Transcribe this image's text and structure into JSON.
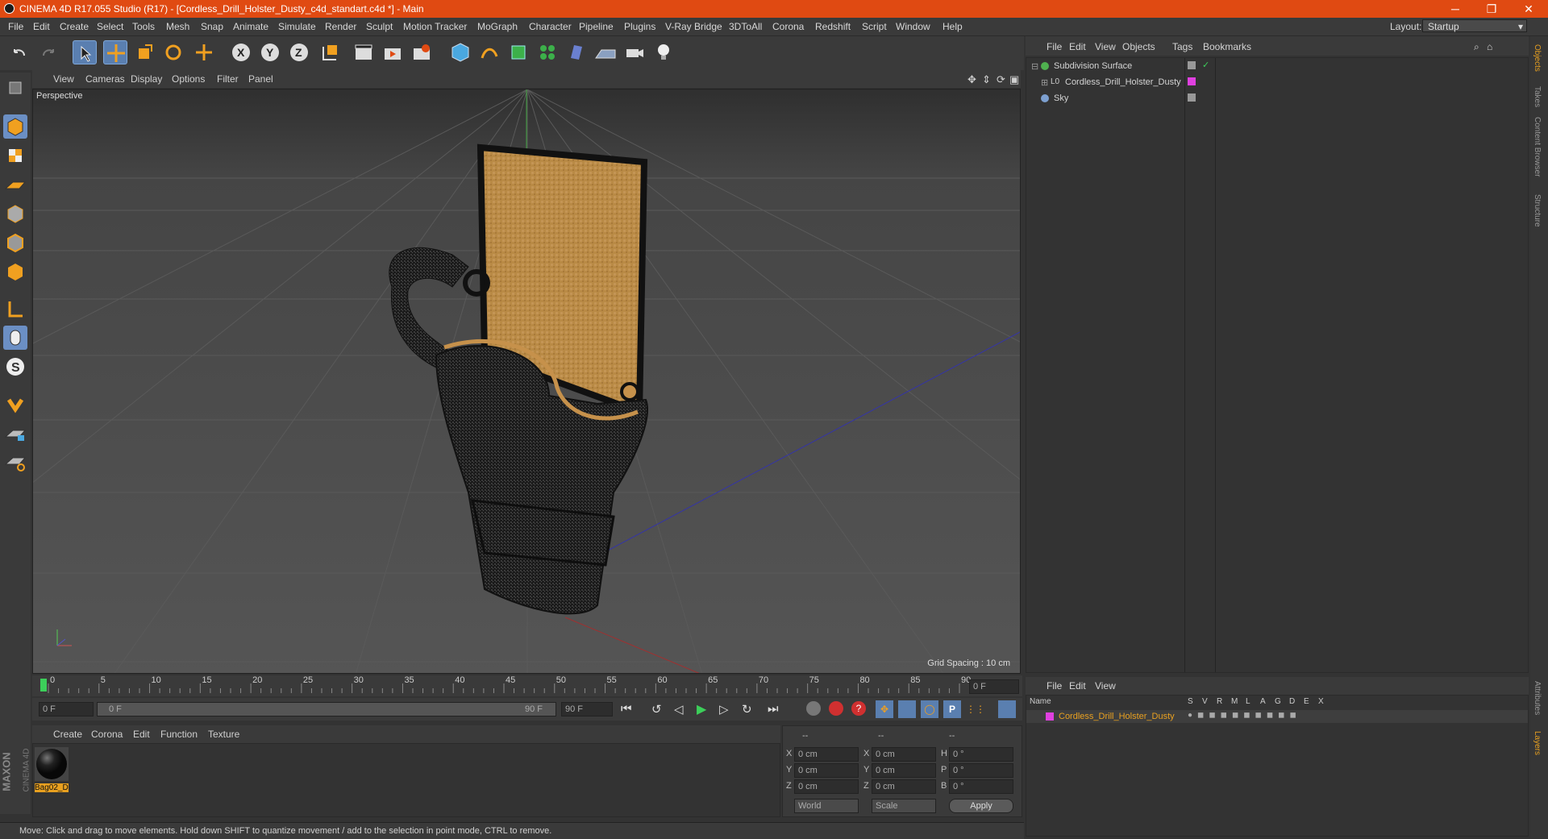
{
  "window": {
    "title": "CINEMA 4D R17.055 Studio (R17) - [Cordless_Drill_Holster_Dusty_c4d_standart.c4d *] - Main",
    "minimize": "─",
    "maximize": "❐",
    "close": "✕"
  },
  "menubar": {
    "items": [
      "File",
      "Edit",
      "Create",
      "Select",
      "Tools",
      "Mesh",
      "Snap",
      "Animate",
      "Simulate",
      "Render",
      "Sculpt",
      "Motion Tracker",
      "MoGraph",
      "Character",
      "Pipeline",
      "Plugins",
      "V-Ray Bridge",
      "3DToAll",
      "Corona",
      "Redshift",
      "Script",
      "Window",
      "Help"
    ],
    "layout_label": "Layout:",
    "layout_value": "Startup"
  },
  "viewport": {
    "menu": [
      "View",
      "Cameras",
      "Display",
      "Options",
      "Filter",
      "Panel"
    ],
    "camera_label": "Perspective",
    "grid_spacing": "Grid Spacing : 10 cm"
  },
  "timeline": {
    "ticks": [
      "0",
      "5",
      "10",
      "15",
      "20",
      "25",
      "30",
      "35",
      "40",
      "45",
      "50",
      "55",
      "60",
      "65",
      "70",
      "75",
      "80",
      "85",
      "90"
    ],
    "current_frame": "0 F",
    "start_frame": "0 F",
    "range_start": "0 F",
    "range_end": "90 F",
    "end_frame": "90 F"
  },
  "material_manager": {
    "menu": [
      "Create",
      "Corona",
      "Edit",
      "Function",
      "Texture"
    ],
    "materials": [
      {
        "name": "Bag02_D"
      }
    ]
  },
  "coordinates": {
    "header": [
      "--",
      "--",
      "--"
    ],
    "rows": [
      {
        "axis": "X",
        "pos": "0 cm",
        "axis2": "X",
        "size": "0 cm",
        "rot_label": "H",
        "rot": "0 °"
      },
      {
        "axis": "Y",
        "pos": "0 cm",
        "axis2": "Y",
        "size": "0 cm",
        "rot_label": "P",
        "rot": "0 °"
      },
      {
        "axis": "Z",
        "pos": "0 cm",
        "axis2": "Z",
        "size": "0 cm",
        "rot_label": "B",
        "rot": "0 °"
      }
    ],
    "space": "World",
    "mode": "Scale",
    "apply": "Apply"
  },
  "object_manager": {
    "menu": [
      "File",
      "Edit",
      "View",
      "Objects",
      "Tags",
      "Bookmarks"
    ],
    "objects": [
      {
        "name": "Subdivision Surface",
        "color": "#4fb04f"
      },
      {
        "name": "Cordless_Drill_Holster_Dusty",
        "color": "#cccccc"
      },
      {
        "name": "Sky",
        "color": "#7da0d0"
      }
    ]
  },
  "layer_manager": {
    "menu": [
      "File",
      "Edit",
      "View"
    ],
    "columns": [
      "Name",
      "S",
      "V",
      "R",
      "M",
      "L",
      "A",
      "G",
      "D",
      "E",
      "X"
    ],
    "layers": [
      {
        "name": "Cordless_Drill_Holster_Dusty",
        "color": "#e040e0"
      }
    ]
  },
  "right_tabs": [
    "Objects",
    "Takes",
    "Content Browser",
    "Structure",
    "Attributes",
    "Layers"
  ],
  "logo": {
    "line1": "MAXON",
    "line2": "CINEMA 4D"
  },
  "status": "Move: Click and drag to move elements. Hold down SHIFT to quantize movement / add to the selection in point mode, CTRL to remove.",
  "colors": {
    "accent": "#e04a12",
    "active_tool": "#5a7fb0",
    "selected_layer": "#e8a020"
  }
}
